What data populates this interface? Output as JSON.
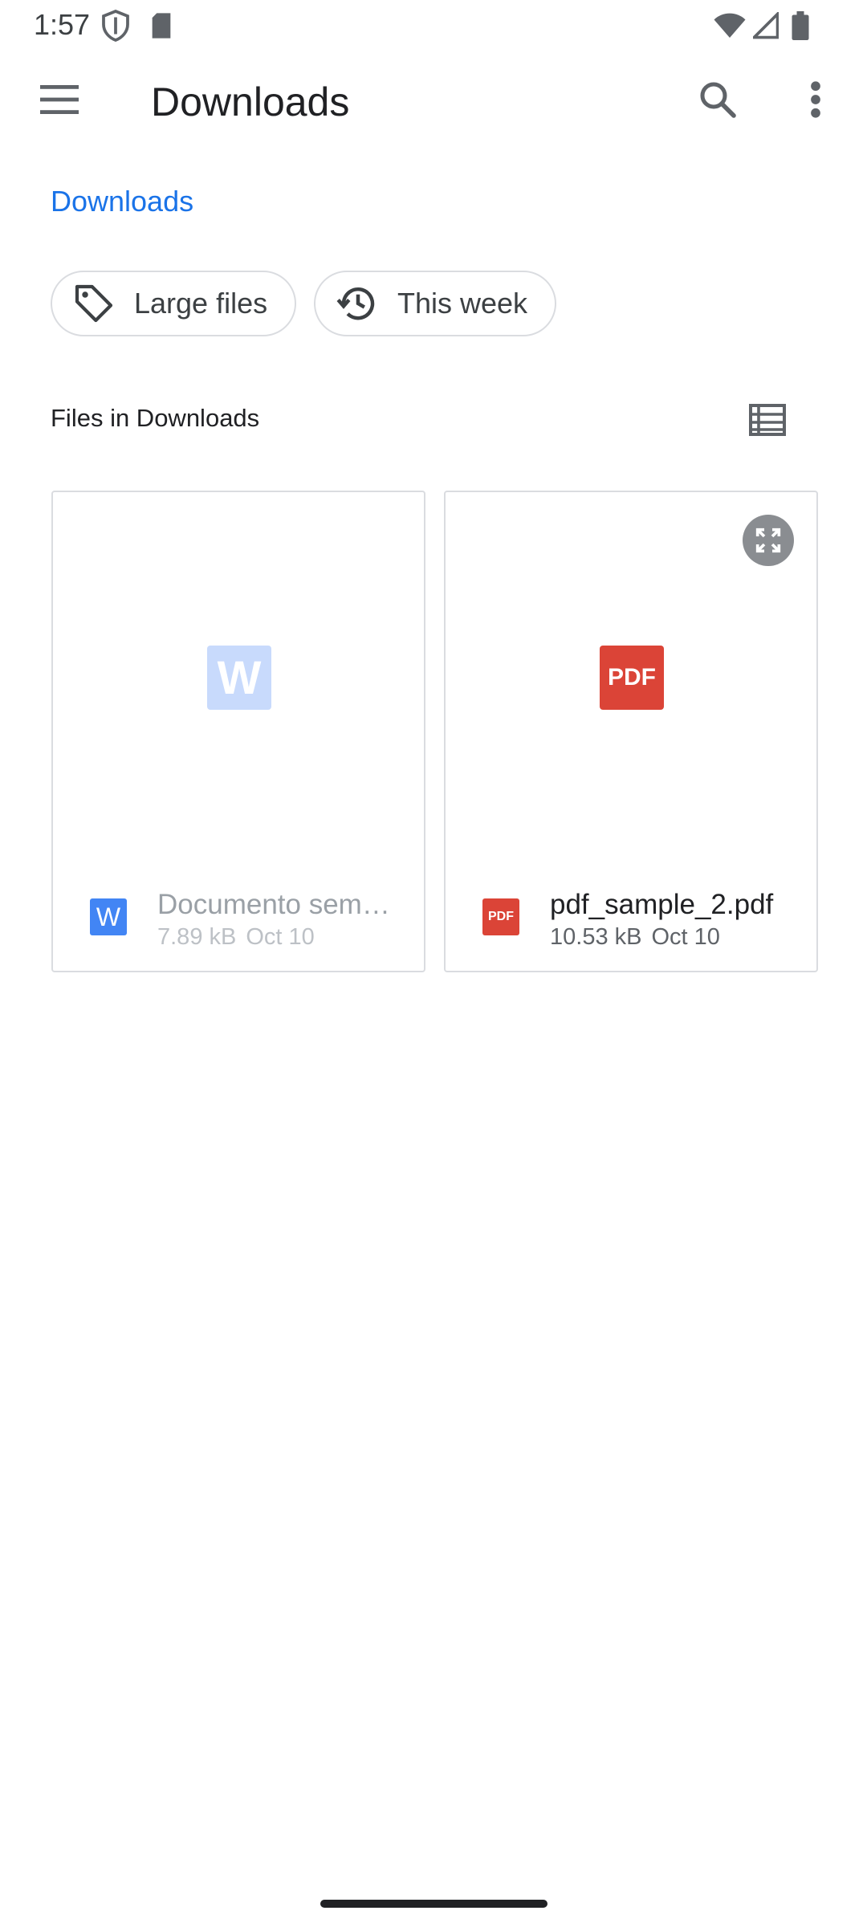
{
  "status_bar": {
    "time": "1:57"
  },
  "app_bar": {
    "title": "Downloads",
    "menu_icon": "menu-icon",
    "search_icon": "search-icon",
    "more_icon": "more-vert-icon"
  },
  "breadcrumb": {
    "label": "Downloads"
  },
  "chips": [
    {
      "label": "Large files",
      "icon": "tag-icon"
    },
    {
      "label": "This week",
      "icon": "history-icon"
    }
  ],
  "section": {
    "title": "Files in Downloads",
    "view_icon": "list-view-icon"
  },
  "files": [
    {
      "name": "Documento sem…",
      "size": "7.89 kB",
      "date": "Oct 10",
      "type_icon": "word-doc-icon",
      "thumb_letter": "W",
      "disabled": true
    },
    {
      "name": "pdf_sample_2.pdf",
      "size": "10.53 kB",
      "date": "Oct 10",
      "type_icon": "pdf-icon",
      "thumb_label": "PDF",
      "small_label": "PDF",
      "disabled": false
    }
  ],
  "colors": {
    "accent": "#1a73e8",
    "word_blue": "#4285f4",
    "pdf_red": "#db4437",
    "text_primary": "#202124",
    "text_secondary": "#5f6368"
  }
}
